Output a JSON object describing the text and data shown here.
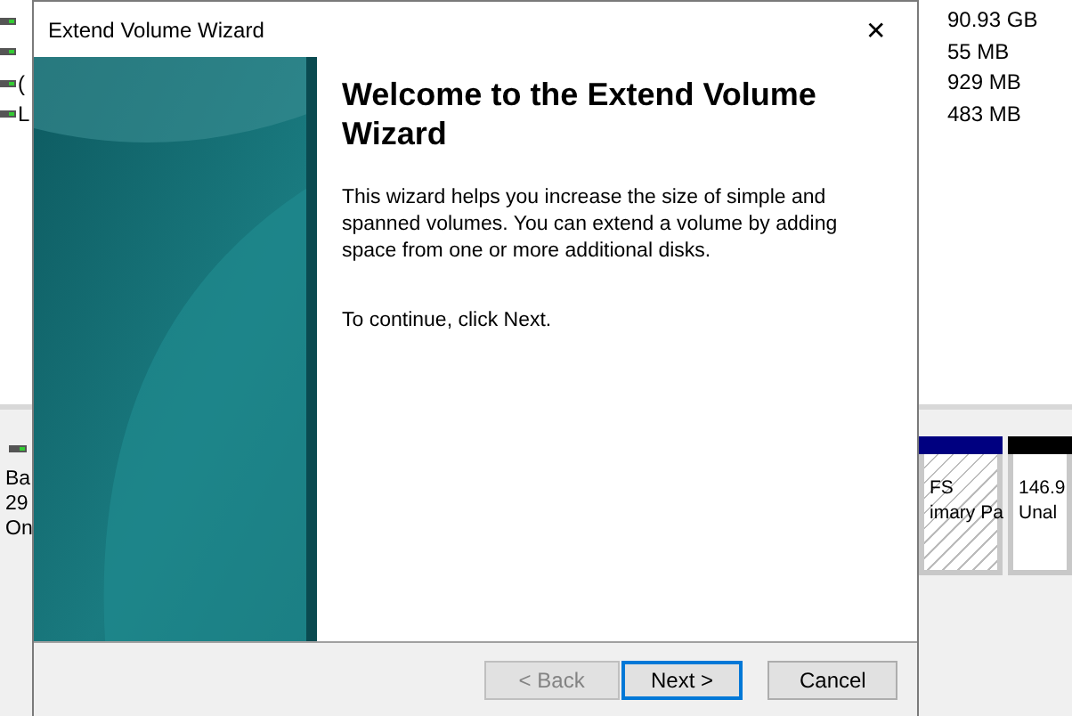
{
  "background_window": {
    "volume_rows": [
      {
        "label": null
      },
      {
        "label": null
      },
      {
        "label": "("
      },
      {
        "label": "L"
      }
    ],
    "capacity_column": [
      "90.93 GB",
      "55 MB",
      "929 MB",
      "483 MB"
    ],
    "disk": {
      "lines": [
        "Ba",
        "29",
        "On"
      ]
    },
    "partitions": [
      {
        "kind": "primary",
        "lines": [
          "FS",
          "imary Pa"
        ]
      },
      {
        "kind": "unallocated",
        "lines": [
          "146.9",
          "Unal"
        ]
      }
    ]
  },
  "wizard": {
    "title": "Extend Volume Wizard",
    "close": "✕",
    "heading": "Welcome to the Extend Volume Wizard",
    "paragraphs": [
      "This wizard helps you increase the size of simple and spanned volumes. You can extend a volume  by adding space from one or more additional disks.",
      "To continue, click Next."
    ],
    "buttons": [
      {
        "label": "< Back",
        "disabled": true,
        "default": false
      },
      {
        "label": "Next >",
        "disabled": false,
        "default": true
      },
      {
        "label": "Cancel",
        "disabled": false,
        "default": false
      }
    ]
  }
}
